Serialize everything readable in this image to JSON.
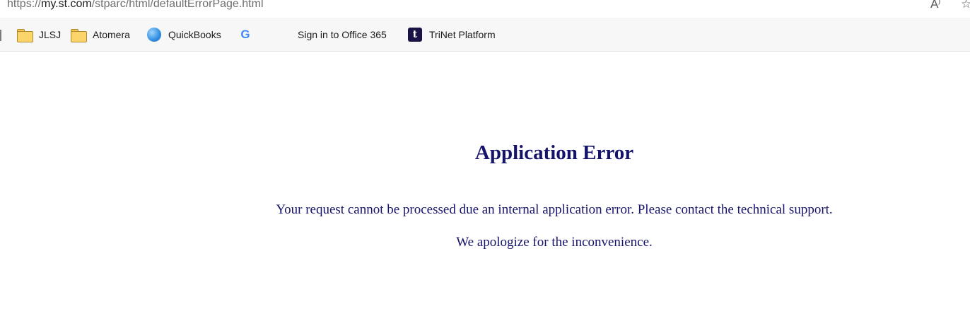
{
  "browser": {
    "url_prefix": "https://",
    "url_host": "my.st.com",
    "url_path": "/stparc/html/defaultErrorPage.html",
    "read_aloud_glyph": "A⁾",
    "favorite_glyph": "☆"
  },
  "bookmarks": [
    {
      "label": "JLSJ",
      "icon": "folder-icon"
    },
    {
      "label": "Atomera",
      "icon": "folder-icon"
    },
    {
      "label": "QuickBooks",
      "icon": "quickbooks-icon"
    },
    {
      "label": "",
      "icon": "google-icon",
      "glyph": "G"
    },
    {
      "label": "Sign in to Office 365",
      "icon": "microsoft-icon"
    },
    {
      "label": "TriNet Platform",
      "icon": "trinet-icon",
      "glyph": "t"
    }
  ],
  "colors": {
    "text_primary": "#16146a",
    "ms_red": "#f25022",
    "ms_green": "#7fba00",
    "ms_blue": "#00a4ef",
    "ms_yellow": "#ffb900"
  },
  "page": {
    "title": "Application Error",
    "message": "Your request cannot be processed due an internal application error. Please contact the technical support.",
    "apology": "We apologize for the inconvenience."
  }
}
